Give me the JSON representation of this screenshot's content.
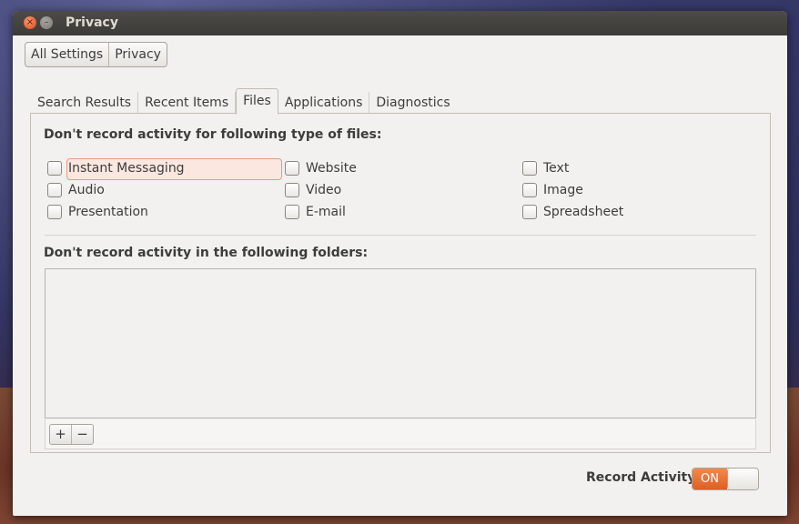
{
  "window": {
    "title": "Privacy"
  },
  "breadcrumb": [
    "All Settings",
    "Privacy"
  ],
  "tabs": [
    {
      "label": "Search Results",
      "active": false
    },
    {
      "label": "Recent Items",
      "active": false
    },
    {
      "label": "Files",
      "active": true
    },
    {
      "label": "Applications",
      "active": false
    },
    {
      "label": "Diagnostics",
      "active": false
    }
  ],
  "files": {
    "heading": "Don't record activity for following type of files:",
    "types": [
      {
        "label": "Instant Messaging",
        "checked": false,
        "focused": true
      },
      {
        "label": "Audio",
        "checked": false
      },
      {
        "label": "Presentation",
        "checked": false
      },
      {
        "label": "Website",
        "checked": false
      },
      {
        "label": "Video",
        "checked": false
      },
      {
        "label": "E-mail",
        "checked": false
      },
      {
        "label": "Text",
        "checked": false
      },
      {
        "label": "Image",
        "checked": false
      },
      {
        "label": "Spreadsheet",
        "checked": false
      }
    ]
  },
  "folders": {
    "heading": "Don't record activity in the following folders:",
    "add_symbol": "+",
    "remove_symbol": "−"
  },
  "record_activity": {
    "label": "Record Activity",
    "state_label": "ON",
    "enabled": true
  },
  "colors": {
    "accent": "#e05f22",
    "titlebar": "#3c3b37",
    "window_bg": "#f2f1f0"
  }
}
